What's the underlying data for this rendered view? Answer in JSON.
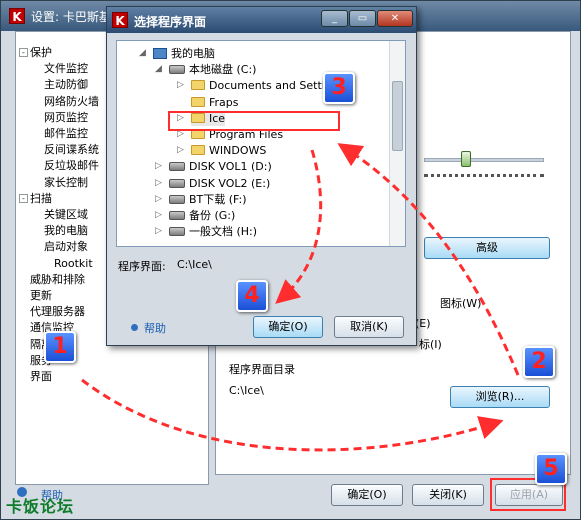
{
  "main_window": {
    "title": "设置: 卡巴斯基",
    "tree": [
      {
        "label": "保护",
        "level": 0,
        "toggle": "-"
      },
      {
        "label": "文件监控",
        "level": 1
      },
      {
        "label": "主动防御",
        "level": 1
      },
      {
        "label": "网络防火墙",
        "level": 1
      },
      {
        "label": "网页监控",
        "level": 1
      },
      {
        "label": "邮件监控",
        "level": 1
      },
      {
        "label": "反间谍系统",
        "level": 1
      },
      {
        "label": "反垃圾邮件",
        "level": 1
      },
      {
        "label": "家长控制",
        "level": 1
      },
      {
        "label": "扫描",
        "level": 0,
        "toggle": "-"
      },
      {
        "label": "关键区域",
        "level": 1
      },
      {
        "label": "我的电脑",
        "level": 1
      },
      {
        "label": "启动对象",
        "level": 1
      },
      {
        "label": "Rootkit",
        "level": 2
      },
      {
        "label": "威胁和排除",
        "level": 0
      },
      {
        "label": "更新",
        "level": 0
      },
      {
        "label": "代理服务器",
        "level": 0
      },
      {
        "label": "通信监控",
        "level": 0
      },
      {
        "label": "隔离",
        "level": 0
      },
      {
        "label": "服务",
        "level": 0
      },
      {
        "label": "界面",
        "level": 0
      }
    ],
    "advanced_button": "高级",
    "checkbox_1": "图标(W)",
    "checkbox_2": "(E)",
    "checkbox_3": "标(I)",
    "group_label": "程序界面目录",
    "path_value": "C:\\Ice\\",
    "browse_button": "浏览(R)...",
    "help_label": "帮助",
    "ok_button": "确定(O)",
    "close_button": "关闭(K)",
    "apply_button": "应用(A)"
  },
  "dialog": {
    "title": "选择程序界面",
    "items": [
      {
        "label": "我的电脑",
        "icon": "computer",
        "indent": 0,
        "toggle": "-"
      },
      {
        "label": "本地磁盘 (C:)",
        "icon": "drive",
        "indent": 1,
        "toggle": "-"
      },
      {
        "label": "Documents and Settings",
        "icon": "folder",
        "indent": 2,
        "toggle": ">"
      },
      {
        "label": "Fraps",
        "icon": "folder",
        "indent": 2,
        "toggle": ""
      },
      {
        "label": "Ice",
        "icon": "folder",
        "indent": 2,
        "toggle": ">",
        "selected": true
      },
      {
        "label": "Program Files",
        "icon": "folder",
        "indent": 2,
        "toggle": ">"
      },
      {
        "label": "WINDOWS",
        "icon": "folder",
        "indent": 2,
        "toggle": ">"
      },
      {
        "label": "DISK VOL1 (D:)",
        "icon": "drive",
        "indent": 1,
        "toggle": ">"
      },
      {
        "label": "DISK VOL2 (E:)",
        "icon": "drive",
        "indent": 1,
        "toggle": ">"
      },
      {
        "label": "BT下载 (F:)",
        "icon": "drive",
        "indent": 1,
        "toggle": ">"
      },
      {
        "label": "备份 (G:)",
        "icon": "drive",
        "indent": 1,
        "toggle": ">"
      },
      {
        "label": "一般文档 (H:)",
        "icon": "drive",
        "indent": 1,
        "toggle": ">"
      }
    ],
    "path_label": "程序界面:",
    "path_value": "C:\\Ice\\",
    "help_label": "帮助",
    "ok_button": "确定(O)",
    "cancel_button": "取消(K)"
  },
  "badges": [
    "1",
    "2",
    "3",
    "4",
    "5"
  ],
  "watermark": "卡饭论坛",
  "colors": {
    "annotation": "#ff2d2d",
    "badge": "#1a4fd6"
  }
}
